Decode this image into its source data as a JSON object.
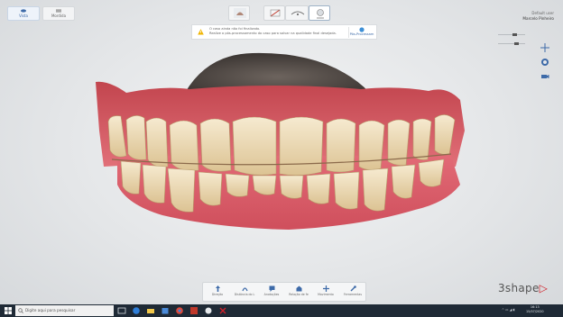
{
  "top_left": {
    "view_buttons": [
      {
        "label": "Vista",
        "active": true
      },
      {
        "label": "Mordida",
        "active": false
      }
    ]
  },
  "notification": {
    "message_line1": "O caso ainda não foi finalizado.",
    "message_line2": "Realize o pós-processamento do caso para salvar na qualidade final desejada.",
    "action_label": "Pós-Processam"
  },
  "user": {
    "role": "Default user",
    "name": "Marcelo Pinheiro"
  },
  "toolbar": {
    "buttons": [
      "scan-tooth-icon",
      "crop-icon",
      "model-icon",
      "lighting-icon"
    ],
    "active_index": 3
  },
  "bottom_tools": [
    {
      "label": "Direção",
      "icon": "arrow-icon"
    },
    {
      "label": "Distância do L",
      "icon": "distance-icon"
    },
    {
      "label": "Anotações",
      "icon": "annotation-icon"
    },
    {
      "label": "Relação de fe",
      "icon": "relation-icon"
    },
    {
      "label": "Movimento",
      "icon": "movement-icon"
    },
    {
      "label": "Ferramentas",
      "icon": "tools-icon"
    }
  ],
  "brand": {
    "text": "3shape",
    "accent": "▷"
  },
  "taskbar": {
    "search_placeholder": "Digite aqui para pesquisar",
    "time": "16:13",
    "date": "15/07/2020"
  },
  "colors": {
    "accent": "#3d6aa8",
    "warning": "#f0b400",
    "brand_red": "#d0212a",
    "taskbar": "#1f2a36"
  }
}
